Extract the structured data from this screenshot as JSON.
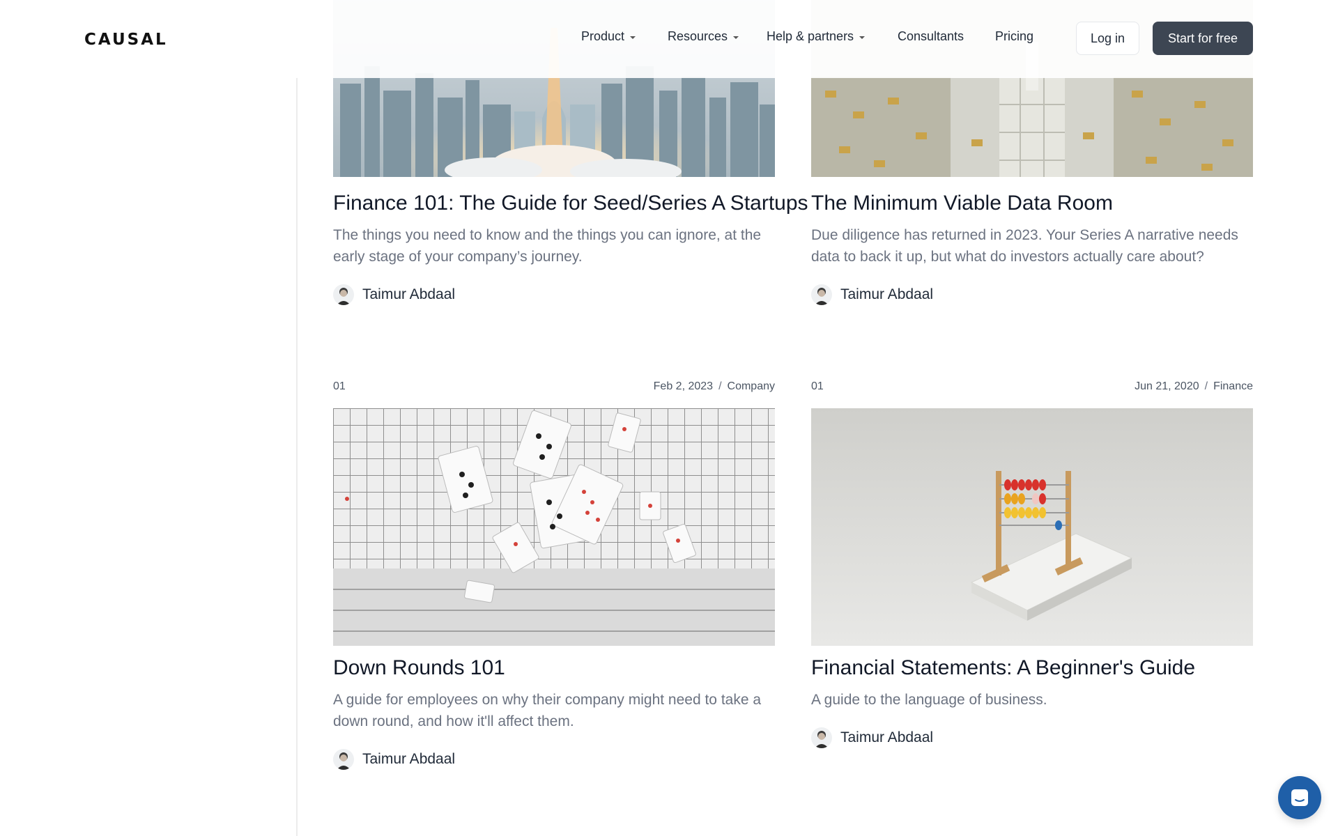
{
  "header": {
    "logo": "CAUSAL",
    "nav": [
      {
        "label": "Product",
        "dropdown": true
      },
      {
        "label": "Resources",
        "dropdown": true
      },
      {
        "label": "Help & partners",
        "dropdown": true
      },
      {
        "label": "Consultants",
        "dropdown": false
      },
      {
        "label": "Pricing",
        "dropdown": false
      }
    ],
    "login_label": "Log in",
    "start_label": "Start for free"
  },
  "cards": [
    {
      "title": "Finance 101: The Guide for Seed/Series A Startups",
      "description": "The things you need to know and the things you can ignore, at the early stage of your company’s journey.",
      "author": "Taimur Abdaal",
      "image": "city-rocket-launch-image"
    },
    {
      "title": "The Minimum Viable Data Room",
      "description": "Due diligence has returned in 2023. Your Series A narrative needs data to back it up, but what do investors actually care about?",
      "author": "Taimur Abdaal",
      "image": "gold-data-room-image"
    },
    {
      "number": "01",
      "date": "Feb 2, 2023",
      "category": "Company",
      "title": "Down Rounds 101",
      "description": "A guide for employees on why their company might need to take a down round, and how it'll affect them.",
      "author": "Taimur Abdaal",
      "image": "falling-cards-image"
    },
    {
      "number": "01",
      "date": "Jun 21, 2020",
      "category": "Finance",
      "title": "Financial Statements: A Beginner's Guide",
      "description": "A guide to the language of business.",
      "author": "Taimur Abdaal",
      "image": "abacus-image"
    }
  ],
  "meta_separator": "/",
  "chat": {
    "icon": "chat-icon"
  },
  "colors": {
    "primary_button": "#3d4653",
    "chat_button": "#1f5fa8",
    "text_muted": "#6b7280"
  }
}
